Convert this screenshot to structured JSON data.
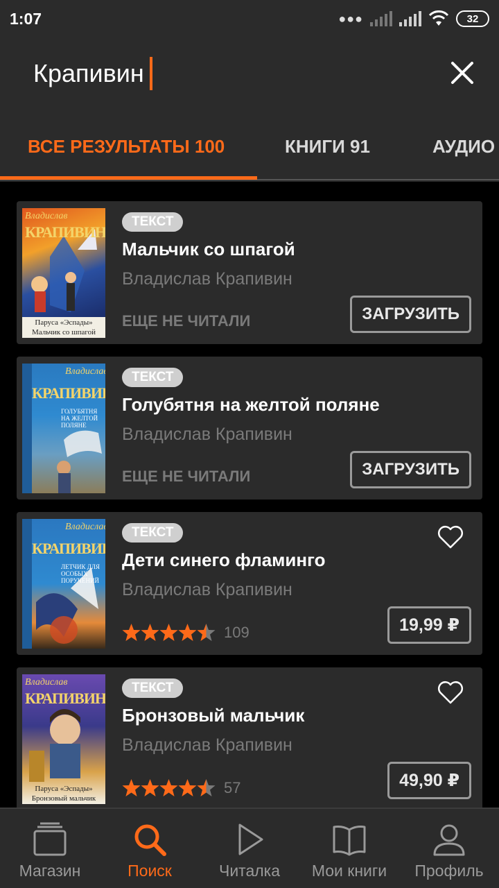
{
  "status_bar": {
    "time": "1:07",
    "battery": "32"
  },
  "search": {
    "query": "Крапивин"
  },
  "tabs": [
    {
      "label": "ВСЕ РЕЗУЛЬТАТЫ 100"
    },
    {
      "label": "КНИГИ 91"
    },
    {
      "label": "АУДИО"
    }
  ],
  "books": [
    {
      "badge": "ТЕКСТ",
      "title": "Мальчик со шпагой",
      "author": "Владислав Крапивин",
      "status": "ЕЩЕ НЕ ЧИТАЛИ",
      "button": "ЗАГРУЗИТЬ",
      "cover": {
        "top": "Владислав",
        "big": "КРАПИВИН",
        "caption": "Паруса «Эспады»\nМальчик со шпагой"
      }
    },
    {
      "badge": "ТЕКСТ",
      "title": "Голубятня на желтой поляне",
      "author": "Владислав Крапивин",
      "status": "ЕЩЕ НЕ ЧИТАЛИ",
      "button": "ЗАГРУЗИТЬ",
      "cover": {
        "top": "Владислав",
        "big": "КРАПИВИН",
        "side": "ГОЛУБЯТНЯ НА ЖЕЛТОЙ ПОЛЯНЕ"
      }
    },
    {
      "badge": "ТЕКСТ",
      "title": "Дети синего фламинго",
      "author": "Владислав Крапивин",
      "rating": 4.5,
      "rating_count": "109",
      "price": "19,99 ₽",
      "cover": {
        "top": "Владислав",
        "big": "КРАПИВИН",
        "side": "ЛЕТЧИК ДЛЯ ОСОБЫХ ПОРУЧЕНИЙ"
      }
    },
    {
      "badge": "ТЕКСТ",
      "title": "Бронзовый мальчик",
      "author": "Владислав Крапивин",
      "rating": 4.5,
      "rating_count": "57",
      "price": "49,90 ₽",
      "cover": {
        "top": "Владислав",
        "big": "КРАПИВИН",
        "caption": "Паруса «Эспады»\nБронзовый мальчик"
      }
    }
  ],
  "bottom_nav": [
    {
      "label": "Магазин",
      "icon": "store-icon"
    },
    {
      "label": "Поиск",
      "icon": "search-icon"
    },
    {
      "label": "Читалка",
      "icon": "play-icon"
    },
    {
      "label": "Мои книги",
      "icon": "open-book-icon"
    },
    {
      "label": "Профиль",
      "icon": "user-icon"
    }
  ],
  "colors": {
    "accent": "#ff6a19",
    "card": "#2b2b2b",
    "background": "#000000"
  }
}
